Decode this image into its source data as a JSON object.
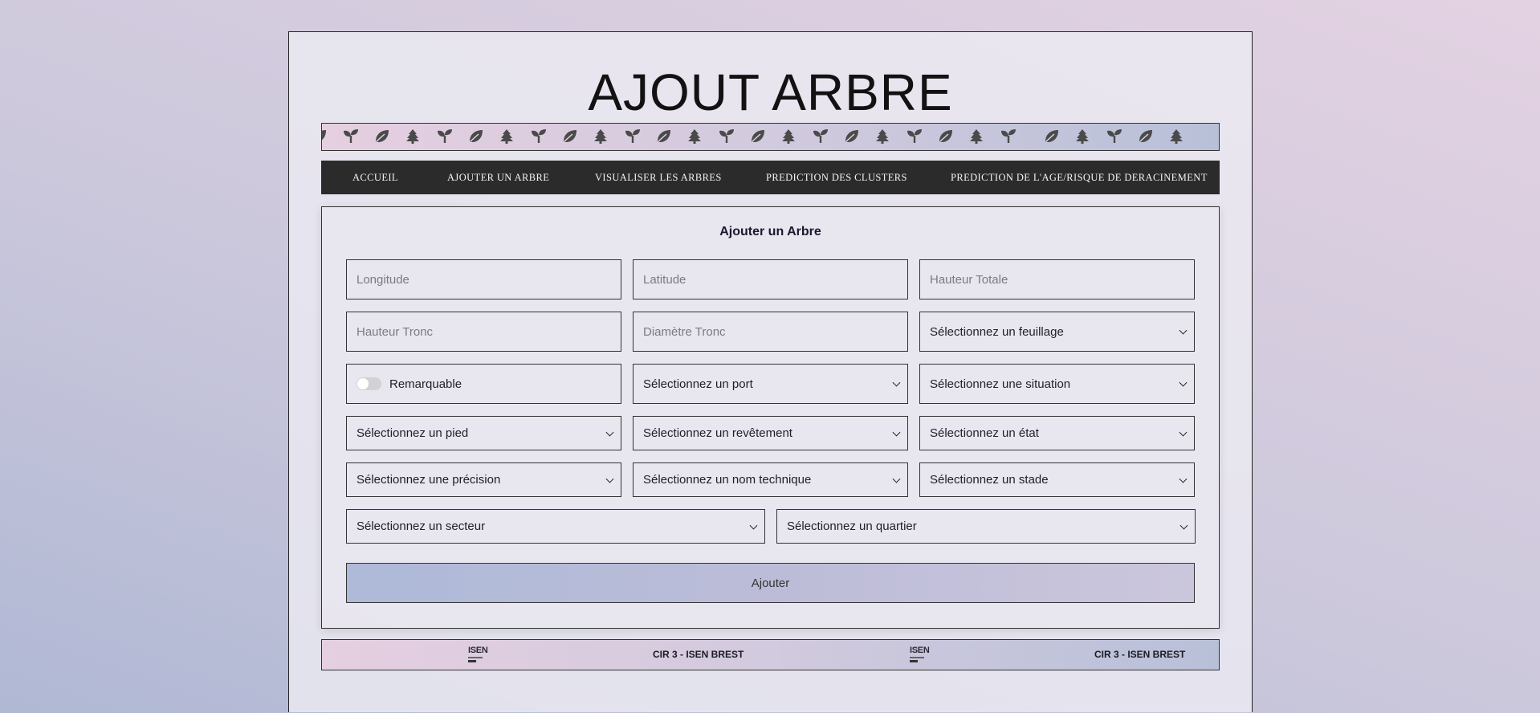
{
  "page": {
    "title": "AJOUT ARBRE"
  },
  "ticker": {
    "icon_sequence": [
      "leaf-icon",
      "sprout-icon",
      "leaf-icon",
      "pine-tree-icon",
      "sprout-icon",
      "leaf-icon",
      "pine-tree-icon",
      "sprout-icon",
      "leaf-icon",
      "pine-tree-icon",
      "sprout-icon",
      "leaf-icon",
      "pine-tree-icon",
      "sprout-icon",
      "leaf-icon",
      "pine-tree-icon",
      "sprout-icon",
      "leaf-icon",
      "pine-tree-icon",
      "sprout-icon",
      "leaf-icon",
      "pine-tree-icon",
      "sprout-icon",
      "leaf-icon",
      "pine-tree-icon",
      "sprout-icon",
      "leaf-icon",
      "pine-tree-icon"
    ],
    "icon_color": "#4a4a4a"
  },
  "nav": {
    "items": [
      {
        "label": "Accueil"
      },
      {
        "label": "Ajouter un Arbre"
      },
      {
        "label": "Visualiser les Arbres"
      },
      {
        "label": "Prediction des clusters"
      },
      {
        "label": "Prediction de l'age/risque de deracinement"
      }
    ]
  },
  "form": {
    "title": "Ajouter un Arbre",
    "longitude_placeholder": "Longitude",
    "latitude_placeholder": "Latitude",
    "hauteur_totale_placeholder": "Hauteur Totale",
    "hauteur_tronc_placeholder": "Hauteur Tronc",
    "diametre_tronc_placeholder": "Diamètre Tronc",
    "feuillage_select": "Sélectionnez un feuillage",
    "remarquable_label": "Remarquable",
    "port_select": "Sélectionnez un port",
    "situation_select": "Sélectionnez une situation",
    "pied_select": "Sélectionnez un pied",
    "revetement_select": "Sélectionnez un revêtement",
    "etat_select": "Sélectionnez un état",
    "precision_select": "Sélectionnez une précision",
    "nom_technique_select": "Sélectionnez un nom technique",
    "stade_select": "Sélectionnez un stade",
    "secteur_select": "Sélectionnez un secteur",
    "quartier_select": "Sélectionnez un quartier",
    "submit_label": "Ajouter"
  },
  "footer": {
    "logo_text": "ISEN",
    "text_1": "CIR 3 - ISEN BREST",
    "text_2": "CIR 3 - ISEN BREST"
  }
}
